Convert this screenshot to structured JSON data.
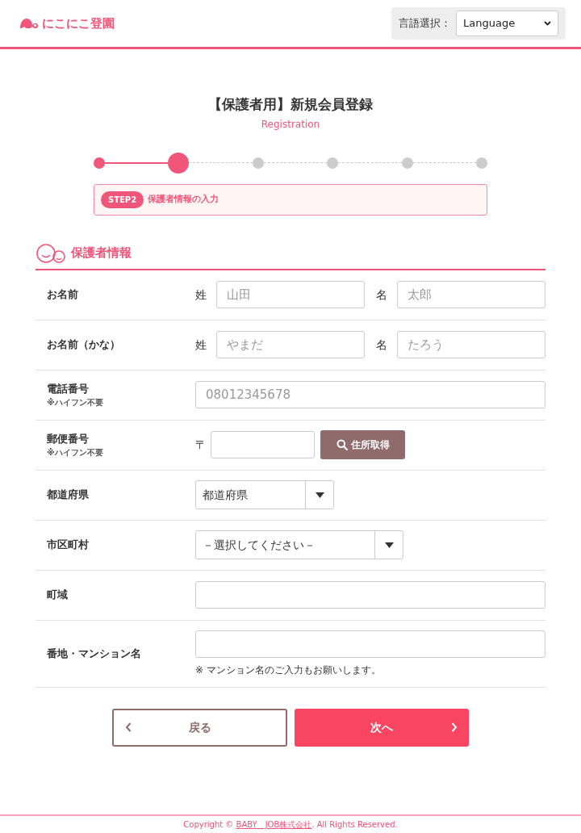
{
  "header": {
    "logo": "にこにこ登園",
    "language": {
      "label": "言語選択：",
      "value": "Language"
    }
  },
  "title": "【保護者用】新規会員登録",
  "subtitle": "Registration",
  "steps": [
    {
      "done": true,
      "selected": false
    },
    {
      "done": true,
      "selected": true
    },
    {
      "done": false,
      "selected": false
    },
    {
      "done": false,
      "selected": false
    },
    {
      "done": false,
      "selected": false
    },
    {
      "done": false,
      "selected": false
    }
  ],
  "step_box": {
    "badge": "STEP2",
    "text": "保護者情報の入力"
  },
  "section": {
    "title": "保護者情報"
  },
  "rows": [
    {
      "kind": "name",
      "label": "お名前",
      "fields": [
        {
          "prefix": "姓",
          "placeholder": "山田"
        },
        {
          "prefix": "名",
          "placeholder": "太郎"
        }
      ]
    },
    {
      "kind": "name",
      "label": "お名前（かな）",
      "fields": [
        {
          "prefix": "姓",
          "placeholder": "やまだ"
        },
        {
          "prefix": "名",
          "placeholder": "たろう"
        }
      ]
    },
    {
      "kind": "text",
      "label": "電話番号",
      "note": "※ハイフン不要",
      "placeholder": "08012345678"
    },
    {
      "kind": "postal",
      "label": "郵便番号",
      "note": "※ハイフン不要",
      "prefix": "〒",
      "button": "住所取得"
    },
    {
      "kind": "select",
      "label": "都道府県",
      "value": "都道府県"
    },
    {
      "kind": "wideselect",
      "label": "市区町村",
      "value": "－選択してください－"
    },
    {
      "kind": "text",
      "label": "町域"
    },
    {
      "kind": "text",
      "label": "番地・マンション名",
      "hint": "※ マンション名のご入力もお願いします。"
    }
  ],
  "buttons": {
    "back": "戻る",
    "next": "次へ"
  },
  "footer": {
    "before": "Copyright © ",
    "link": "BABY　JOB株式会社",
    "after": ". All Rights Reserved."
  }
}
